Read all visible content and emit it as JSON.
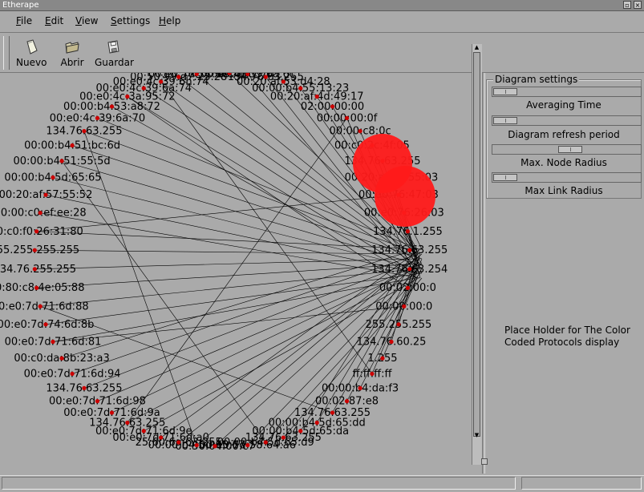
{
  "window": {
    "title": "Etherape"
  },
  "menu": [
    {
      "label": "File",
      "key": "F",
      "rest": "ile"
    },
    {
      "label": "Edit",
      "key": "E",
      "rest": "dit"
    },
    {
      "label": "View",
      "key": "V",
      "rest": "iew"
    },
    {
      "label": "Settings",
      "key": "S",
      "rest": "ettings"
    },
    {
      "label": "Help",
      "key": "H",
      "rest": "elp"
    }
  ],
  "toolbar": {
    "new_label": "Nuevo",
    "open_label": "Abrir",
    "save_label": "Guardar"
  },
  "diagram_settings": {
    "title": "Diagram settings",
    "averaging_time": {
      "label": "Averaging Time",
      "value": 0.0
    },
    "refresh_period": {
      "label": "Diagram refresh period",
      "value": 0.0
    },
    "max_node_radius": {
      "label": "Max. Node Radius",
      "value": 0.52
    },
    "max_link_radius": {
      "label": "Max Link Radius",
      "value": 0.0
    }
  },
  "protocols_placeholder": "Place Holder for The Color Coded Protocols display",
  "colors": {
    "node": "#cc0000",
    "big_node": "#ff1a1a",
    "link": "#000000",
    "bg": "#aaaaaa"
  },
  "node_labels": [
    "00:00:b4:5f:fc:7d",
    "00:e0:7d:71:60:7d",
    "00:50:99:d7:23:28",
    "00:e0:4c:39:6h:74",
    "00:e0:4c:39:6a:74",
    "00:e0:4c:3a:95:72",
    "00:00:b4:53:a8:72",
    "00:e0:4c:39:6a:70",
    "134.76.63.255",
    "00:00:b4:51:bc:6d",
    "00:00:b4:51:55:5d",
    "00:00:b4:5d:65:65",
    "00:20:af:57:55:52",
    "00:00:c0:ef:ee:28",
    "00:c0:f0:26:31:80",
    "255.255.255.255",
    "134.76.255.255",
    "00:80:c8:4e:05:88",
    "00:e0:7d:71:6d:88",
    "00:e0:7d:74:6d:8b",
    "00:e0:7d:71:6d:81",
    "00:c0:da:8b:23:a3",
    "00:e0:7d:71:6d:94",
    "134.76.63.255",
    "00:e0:7d:71:6d:98",
    "00:e0:7d:71:6d:9a",
    "134.76.63.255",
    "00:e0:7d:71:6d:9e",
    "00:e0:7d:71:6d:a0",
    "25:60:6a:63:255",
    "00:00:b4:5d:65:67",
    "00:50:04:00:c7",
    "00:e0:7d:58:64:a6",
    "00:00:b4:5d:65:d9",
    "134.76.63.255",
    "00:00:b4:5d:65:da",
    "00:00:b4:5d:65:dd",
    "134.76.63.255",
    "00:02:87:e8",
    "00:00:b4:da:f3",
    "ff:ff:ff:ff",
    "1.255",
    "134.76.60.25",
    "255.255.255",
    "00:00:00:0",
    "00:02:00:0",
    "134.76.63.254",
    "134.76.63.255",
    "134.76.1.255",
    "00:e0:76:26:03",
    "00:e0:76:47:03",
    "00:20:af:57:55:03",
    "134.76.63.255",
    "00:c0:2c:4f:05",
    "00:00:c8:0c",
    "00:00:00:0f",
    "02:00:00:00",
    "00:20:af:4d:49:17",
    "00:00:b4:55:13:23",
    "00:20:af:53:d4:28",
    "134.76.63.255",
    "00:e0:4c:39:6a:6c"
  ]
}
